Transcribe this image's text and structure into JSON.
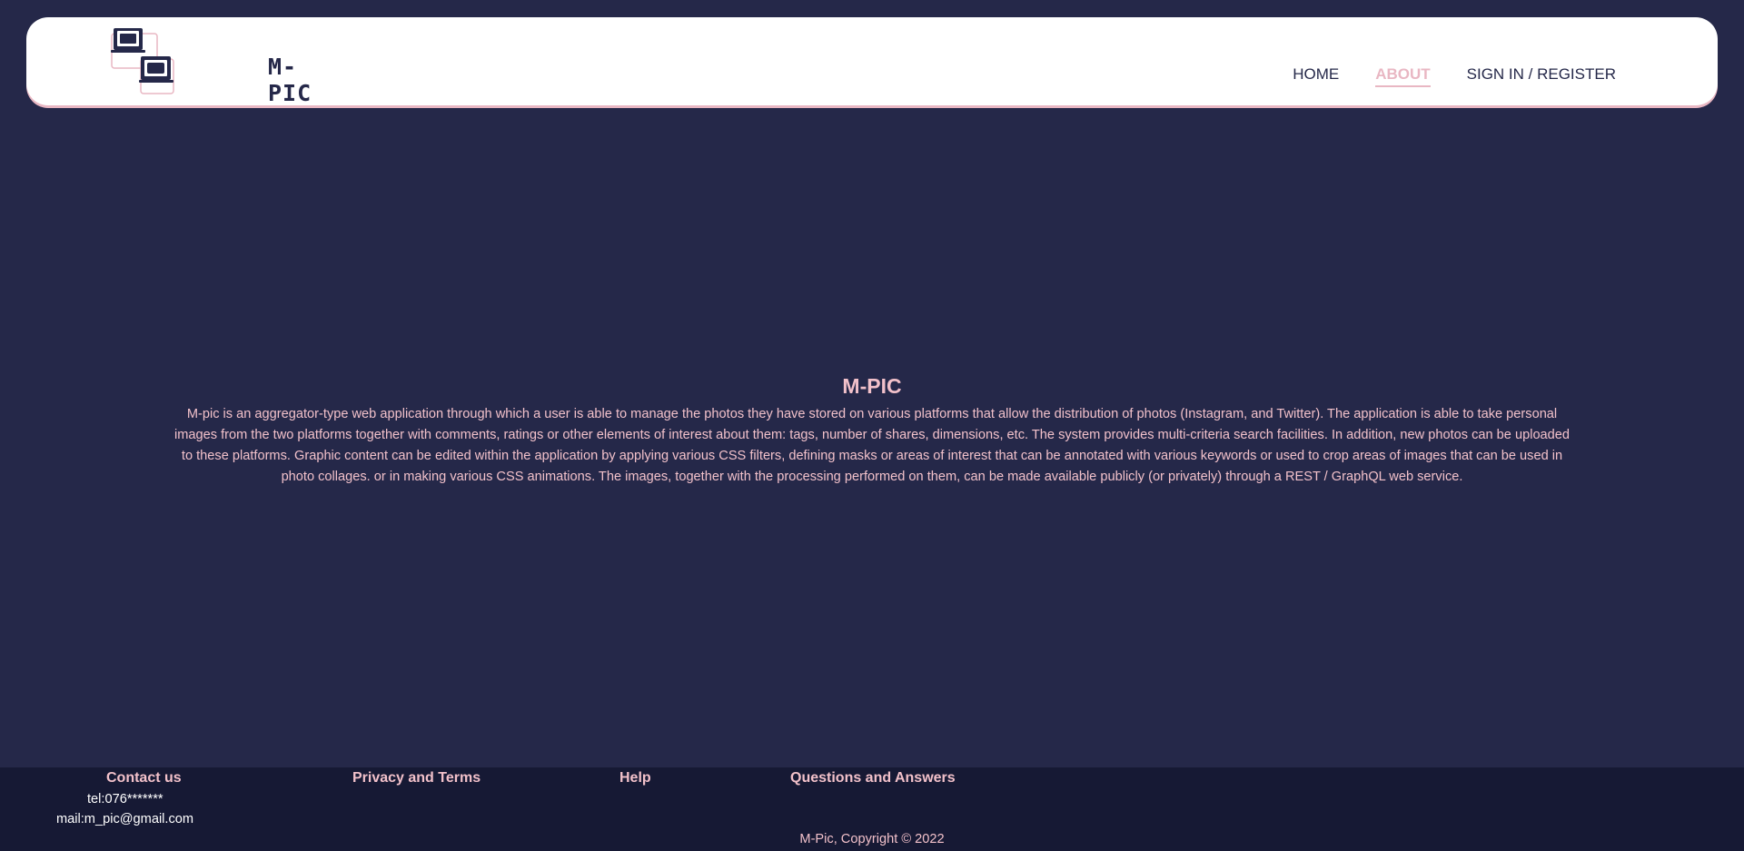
{
  "header": {
    "logo_text": "M-PIC",
    "nav": [
      {
        "label": "HOME",
        "active": false
      },
      {
        "label": "ABOUT",
        "active": true
      },
      {
        "label": "SIGN IN / REGISTER",
        "active": false
      }
    ]
  },
  "main": {
    "title": "M-PIC",
    "description": "M-pic is an aggregator-type web application through which a user is able to manage the photos they have stored on various platforms that allow the distribution of photos (Instagram, and Twitter). The application is able to take personal images from the two platforms together with comments, ratings or other elements of interest about them: tags, number of shares, dimensions, etc. The system provides multi-criteria search facilities. In addition, new photos can be uploaded to these platforms. Graphic content can be edited within the application by applying various CSS filters, defining masks or areas of interest that can be annotated with various keywords or used to crop areas of images that can be used in photo collages. or in making various CSS animations. The images, together with the processing performed on them, can be made available publicly (or privately) through a REST / GraphQL web service."
  },
  "footer": {
    "contact_heading": "Contact us",
    "contact_items": [
      "tel:076*******",
      "mail:m_pic@gmail.com"
    ],
    "privacy_heading": "Privacy and Terms",
    "help_heading": "Help",
    "qa_heading": "Questions and Answers",
    "copyright": "M-Pic, Copyright © 2022"
  },
  "colors": {
    "background": "#252849",
    "footer_background": "#161934",
    "accent_pink": "#f2c1ca",
    "header_background": "#ffffff"
  }
}
